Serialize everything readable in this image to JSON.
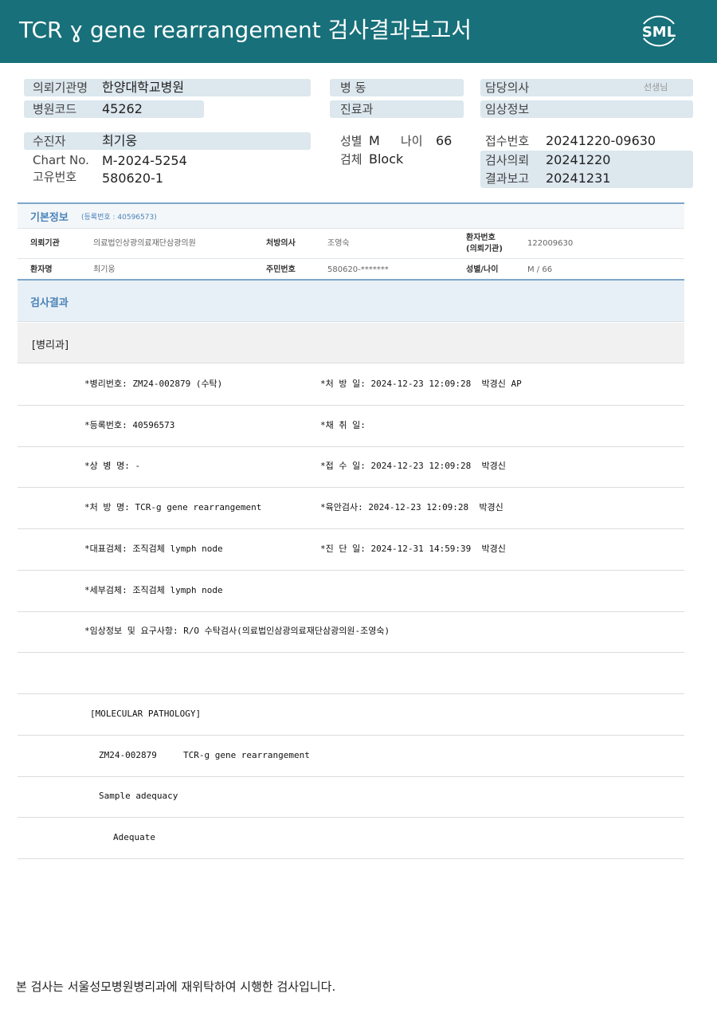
{
  "header": {
    "title": "TCR ɣ gene rearrangement 검사결과보고서",
    "logo_text": "SML",
    "accent_color": "#17707a",
    "logo_icon": "sml-logo-icon"
  },
  "report_info": {
    "institution_label": "의뢰기관명",
    "institution_value": "한양대학교병원",
    "hospital_code_label": "병원코드",
    "hospital_code_value": "45262",
    "ward_label": "병 동",
    "department_label": "진료과",
    "doctor_label": "담당의사",
    "doctor_hint": "선생님",
    "clinical_info_label": "임상정보",
    "patient_label": "수진자",
    "patient_value": "최기웅",
    "chart_no_label": "Chart No.",
    "chart_no_value": "M-2024-5254",
    "unique_no_label": "고유번호",
    "unique_no_value": "580620-1",
    "sex_label": "성별",
    "sex_value": "M",
    "age_label": "나이",
    "age_value": "66",
    "specimen_label": "검체",
    "specimen_value": "Block",
    "receipt_no_label": "접수번호",
    "receipt_no_value": "20241220-09630",
    "request_date_label": "검사의뢰",
    "request_date_value": "20241220",
    "report_date_label": "결과보고",
    "report_date_value": "20241231"
  },
  "basic_info": {
    "title": "기본정보",
    "reg_note": "(등록번호 : 40596573)",
    "row1": {
      "institution_key": "의뢰기관",
      "institution_val": "의료법인상광의료재단삼광의원",
      "prescriber_key": "처방의사",
      "prescriber_val": "조영숙",
      "patient_no_key_1": "환자번호",
      "patient_no_key_2": "(의뢰기관)",
      "patient_no_val": "122009630"
    },
    "row2": {
      "name_key": "환자명",
      "name_val": "최기웅",
      "resident_no_key": "주민번호",
      "resident_no_val": "580620-*******",
      "sex_age_key": "성별/나이",
      "sex_age_val": "M / 66"
    }
  },
  "results": {
    "title": "검사결과",
    "department": "[병리과]",
    "rows": [
      {
        "left": "*병리번호: ZM24-002879 (수탁)",
        "right": "*처 방 일: 2024-12-23 12:09:28  박경신 AP"
      },
      {
        "left": "*등록번호: 40596573",
        "right": "*채 취 일:"
      },
      {
        "left": "*상 병 명: -",
        "right": "*접 수 일: 2024-12-23 12:09:28  박경신"
      },
      {
        "left": "*처 방 명: TCR-g gene rearrangement",
        "right": "*육안검사: 2024-12-23 12:09:28  박경신"
      },
      {
        "left": "*대표검체: 조직검체 lymph node",
        "right": "*진 단 일: 2024-12-31 14:59:39  박경신"
      },
      {
        "left": "*세부검체: 조직검체 lymph node",
        "right": ""
      },
      {
        "left": "*임상정보 및 요구사항: R/O 수탁검사(의료법인삼광의료재단삼광의원-조영숙)",
        "right": ""
      },
      {
        "left": "",
        "right": ""
      },
      {
        "left": "[MOLECULAR PATHOLOGY]",
        "right": ""
      },
      {
        "left": "ZM24-002879     TCR-g gene rearrangement",
        "right": ""
      },
      {
        "left": "Sample adequacy",
        "right": ""
      },
      {
        "left": "Adequate",
        "right": ""
      }
    ]
  },
  "footer": {
    "note": "본 검사는 서울성모병원병리과에 재위탁하여 시행한 검사입니다."
  }
}
